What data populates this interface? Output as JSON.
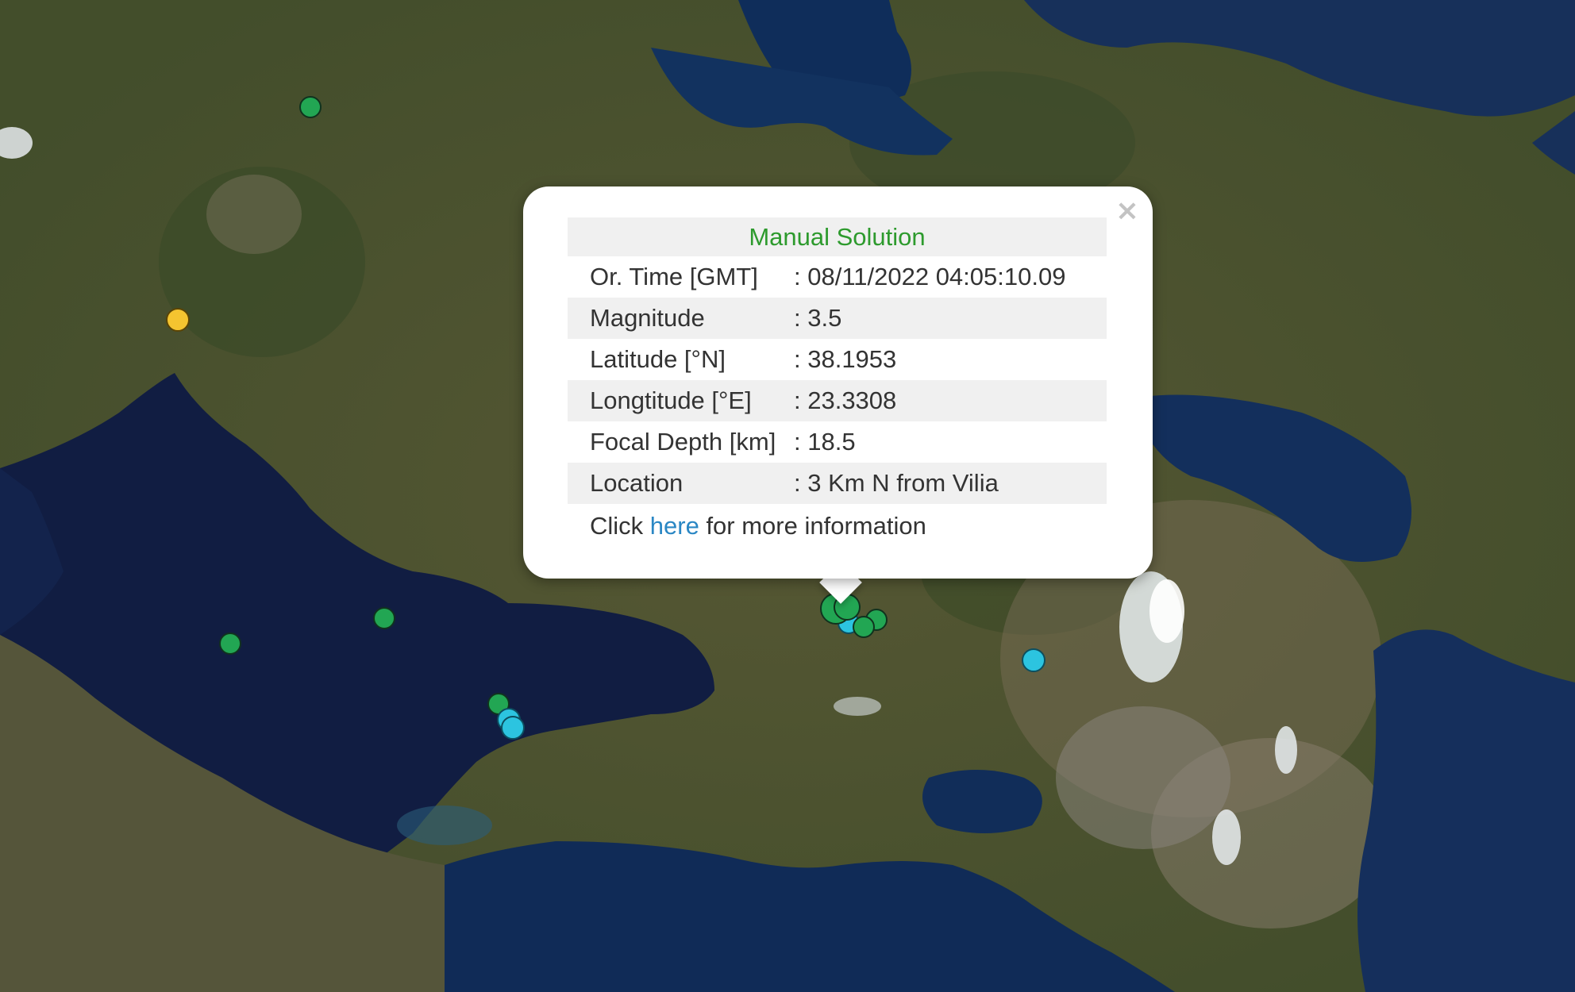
{
  "popup": {
    "title": "Manual Solution",
    "close_glyph": "×",
    "rows": [
      {
        "label": "Or. Time [GMT]",
        "value": ": 08/11/2022 04:05:10.09"
      },
      {
        "label": "Magnitude",
        "value": ": 3.5"
      },
      {
        "label": "Latitude [°N]",
        "value": ": 38.1953"
      },
      {
        "label": "Longtitude [°E]",
        "value": ": 23.3308"
      },
      {
        "label": "Focal Depth [km]",
        "value": ": 18.5"
      },
      {
        "label": "Location",
        "value": ": 3 Km N from Vilia"
      }
    ],
    "more_prefix": "Click ",
    "more_link": "here",
    "more_suffix": " for more information"
  },
  "map": {
    "basemap": "satellite-imagery",
    "marker_legend": {
      "green": "#22a653",
      "cyan": "#2cc4e0",
      "yellow": "#f4c430"
    }
  }
}
